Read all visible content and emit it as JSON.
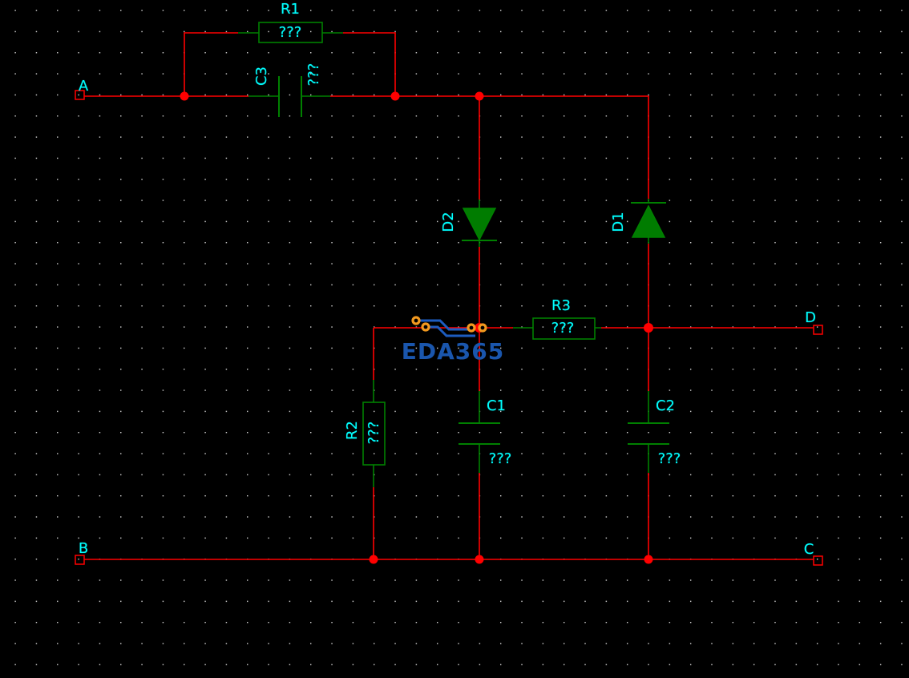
{
  "canvas": {
    "background": "#000000",
    "grid_dot_color": "#ffffff",
    "wire_color": "#ff0000",
    "symbol_color": "#008000",
    "label_color": "#00ffff",
    "junction_color": "#ff0000"
  },
  "watermark": {
    "text": "EDA365",
    "color": "#1a56ad"
  },
  "ports": {
    "a": {
      "label": "A"
    },
    "b": {
      "label": "B"
    },
    "c": {
      "label": "C"
    },
    "d": {
      "label": "D"
    }
  },
  "components": {
    "r1": {
      "ref": "R1",
      "value": "???",
      "type": "resistor"
    },
    "r2": {
      "ref": "R2",
      "value": "???",
      "type": "resistor"
    },
    "r3": {
      "ref": "R3",
      "value": "???",
      "type": "resistor"
    },
    "c1": {
      "ref": "C1",
      "value": "???",
      "type": "capacitor"
    },
    "c2": {
      "ref": "C2",
      "value": "???",
      "type": "capacitor"
    },
    "c3": {
      "ref": "C3",
      "value": "???",
      "type": "capacitor"
    },
    "d1": {
      "ref": "D1",
      "type": "diode"
    },
    "d2": {
      "ref": "D2",
      "type": "diode"
    }
  }
}
